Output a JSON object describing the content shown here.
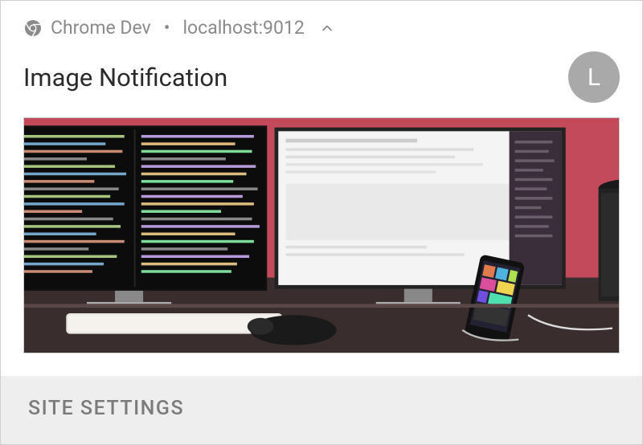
{
  "header": {
    "app_name": "Chrome Dev",
    "origin": "localhost:9012"
  },
  "title": "Image Notification",
  "avatar": {
    "letter": "L"
  },
  "action": {
    "label": "SITE SETTINGS"
  }
}
